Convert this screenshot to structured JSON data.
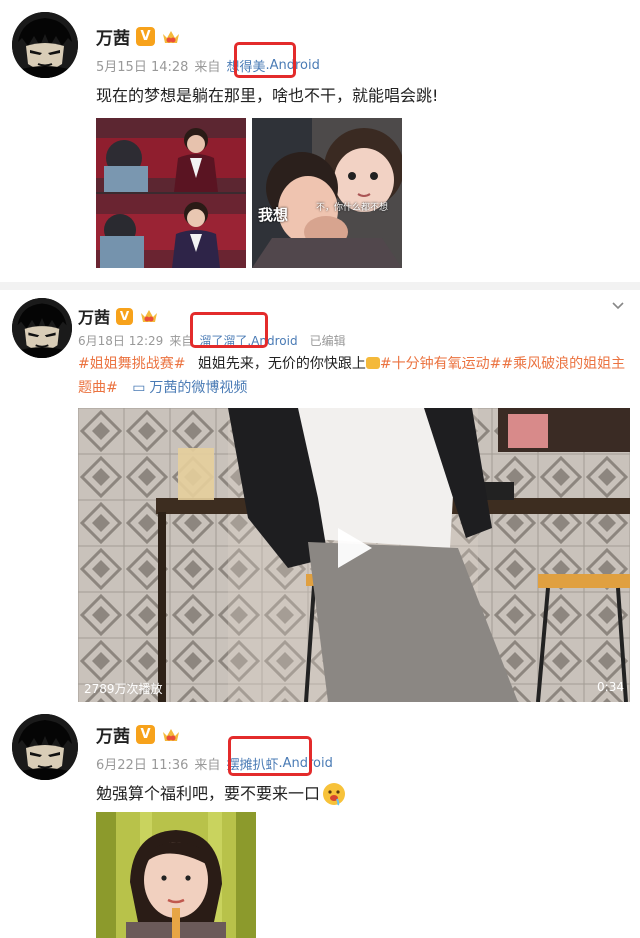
{
  "posts": [
    {
      "username": "万茜",
      "vip": "V",
      "date": "5月15日 14:28",
      "from": "来自",
      "source": "想得美",
      "platform": "Android",
      "text": "现在的梦想是躺在那里，啥也不干，就能唱会跳!",
      "images": [
        {
          "caption_left": "我想",
          "caption_right": "不，你什么都不想"
        }
      ]
    },
    {
      "username": "万茜",
      "vip": "V",
      "date": "6月18日 12:29",
      "from": "来自",
      "source": "溜了溜了",
      "platform": "Android",
      "edited": "已编辑",
      "hashtag1": "#姐姐舞挑战赛#",
      "body1": "姐姐先来，无价的你快跟上",
      "hashtag2": "#十分钟有氧运动#",
      "hashtag3": "#乘风破浪的姐姐主题曲#",
      "video_link": "万茜的微博视频",
      "video": {
        "plays": "2789万次播放",
        "duration": "0:34"
      }
    },
    {
      "username": "万茜",
      "vip": "V",
      "date": "6月22日 11:36",
      "from": "来自",
      "source": "摆摊扒虾",
      "platform": "Android",
      "text": "勉强算个福利吧，要不要来一口"
    }
  ],
  "colors": {
    "accent": "#eb7340",
    "link": "#4a7bb5",
    "highlight": "#e32b2b",
    "vip": "#f7a21b"
  }
}
